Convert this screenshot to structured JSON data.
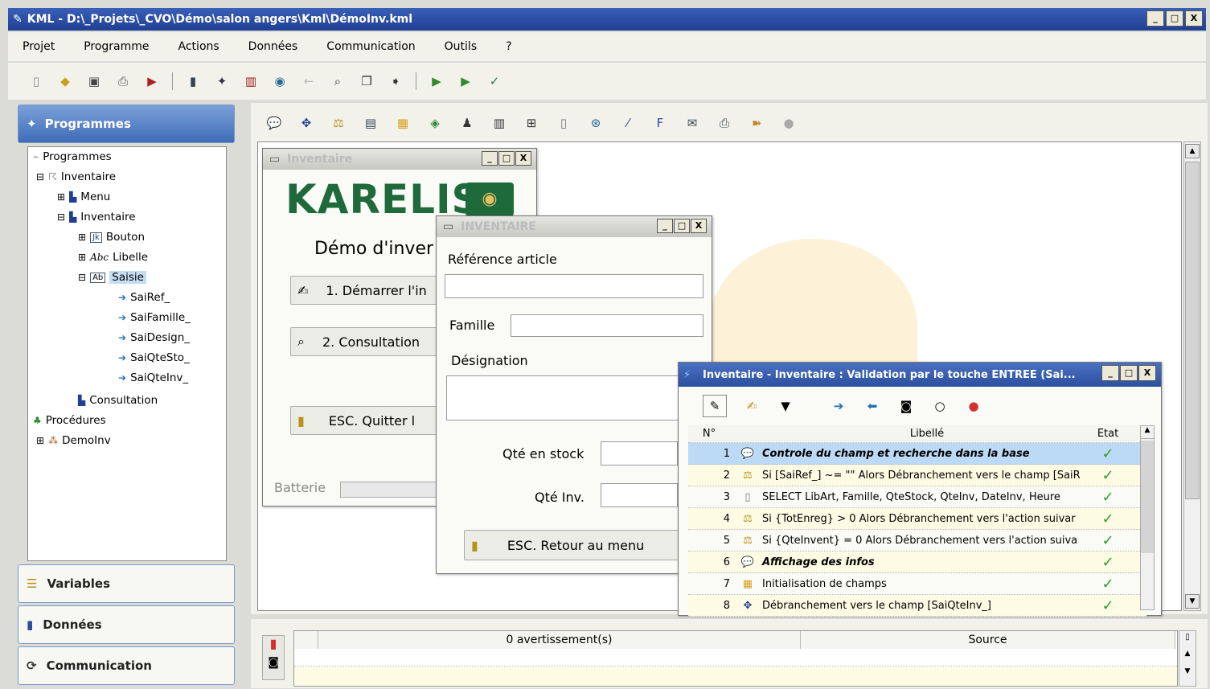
{
  "window": {
    "title": "KML - D:\\_Projets\\_CVO\\Démo\\salon angers\\Kml\\DémoInv.kml",
    "min": "_",
    "max": "□",
    "close": "X"
  },
  "menu": [
    "Projet",
    "Programme",
    "Actions",
    "Données",
    "Communication",
    "Outils",
    "?"
  ],
  "left": {
    "programmes": "Programmes",
    "variables": "Variables",
    "donnees": "Données",
    "communication": "Communication",
    "tree": {
      "root": "Programmes",
      "inventaire": "Inventaire",
      "menu": "Menu",
      "inventaire2": "Inventaire",
      "bouton": "Bouton",
      "bouton_badge": "Jk",
      "libelle": "Libelle",
      "libelle_badge": "Abc",
      "saisie": "Saisie",
      "saisie_badge": "Ab",
      "fields": [
        "SaiRef_",
        "SaiFamille_",
        "SaiDesign_",
        "SaiQteSto_",
        "SaiQteInv_"
      ],
      "consultation": "Consultation",
      "procedures": "Procédures",
      "demoinv": "DemoInv"
    }
  },
  "inv_window": {
    "title": "Inventaire",
    "logo": "KARELIS",
    "heading": "Démo d'inver",
    "btn1": "1. Démarrer l'in",
    "btn2": "2. Consultation",
    "btn3": "ESC. Quitter l",
    "batterie": "Batterie"
  },
  "inventaire_window": {
    "title": "INVENTAIRE",
    "ref_label": "Référence article",
    "famille_label": "Famille",
    "designation_label": "Désignation",
    "stock_label": "Qté en stock",
    "qteinv_label": "Qté Inv.",
    "retour_btn": "ESC. Retour au menu"
  },
  "validation_window": {
    "title": "Inventaire - Inventaire : Validation par le touche ENTREE (Sai...",
    "col_n": "N°",
    "col_libelle": "Libellé",
    "col_etat": "Etat",
    "rows": [
      {
        "n": "1",
        "label": "Controle du champ et recherche dans la base"
      },
      {
        "n": "2",
        "label": "Si [SaiRef_] ~= \"\" Alors Débranchement vers le champ [SaiR"
      },
      {
        "n": "3",
        "label": "SELECT LibArt, Famille, QteStock, QteInv, DateInv, Heure"
      },
      {
        "n": "4",
        "label": "Si {TotEnreg} > 0 Alors Débranchement vers l'action suivar"
      },
      {
        "n": "5",
        "label": "Si {QteInvent} = 0 Alors Débranchement vers l'action suiva"
      },
      {
        "n": "6",
        "label": "Affichage des infos"
      },
      {
        "n": "7",
        "label": "Initialisation de champs"
      },
      {
        "n": "8",
        "label": "Débranchement vers le champ [SaiQteInv_]"
      }
    ],
    "check": "✓"
  },
  "bottom": {
    "warnings": "0 avertissement(s)",
    "source": "Source"
  },
  "colors": {
    "title_blue": "#2a4da0",
    "panel_blue": "#5a85c9",
    "check": "#2e9d32",
    "highlight": "#bcd9f5"
  }
}
